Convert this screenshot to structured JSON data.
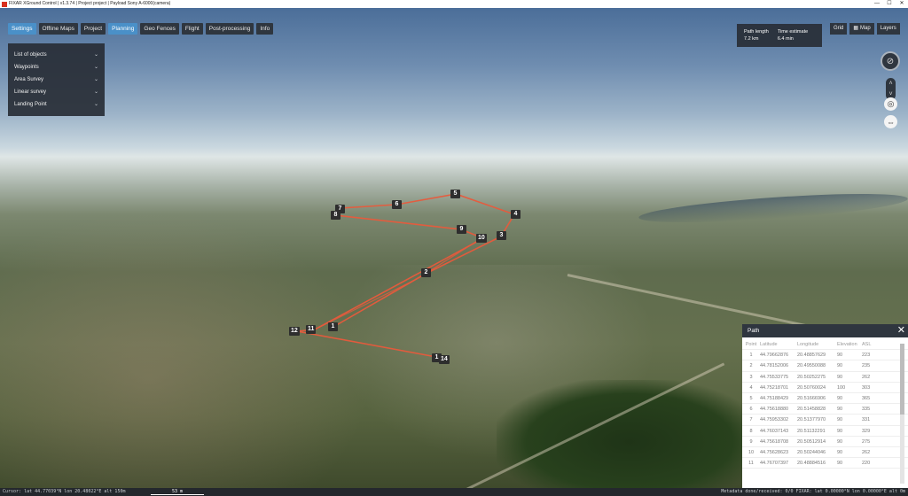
{
  "window": {
    "title": "FIXAR XGround Control | v1.3.74 | Project project | Payload Sony A-6000(camera)",
    "minimize": "—",
    "maximize": "☐",
    "close": "✕"
  },
  "menu": [
    "Settings",
    "Offline Maps",
    "Project",
    "Planning",
    "Geo Fences",
    "Flight",
    "Post-processing",
    "Info"
  ],
  "objects_panel": {
    "items": [
      "List of objects",
      "Waypoints",
      "Area Survey",
      "Linear survey",
      "Landing Point"
    ]
  },
  "path_info": {
    "length_label": "Path length",
    "length_value": "7.2 km",
    "time_label": "Time estimate",
    "time_value": "6.4 min"
  },
  "top_right": {
    "grid": "Grid",
    "map": "Map",
    "layers": "Layers"
  },
  "waypoints": [
    "1",
    "2",
    "3",
    "4",
    "5",
    "6",
    "7",
    "8",
    "9",
    "10",
    "11",
    "12",
    "1",
    "14"
  ],
  "path_panel": {
    "title": "Path",
    "columns": [
      "Point",
      "Latitude",
      "Longitude",
      "Elevation",
      "ASL"
    ],
    "rows": [
      [
        "1",
        "44.79662876",
        "20.48857629",
        "90",
        "223"
      ],
      [
        "2",
        "44.78152006",
        "20.49550088",
        "90",
        "235"
      ],
      [
        "3",
        "44.75533775",
        "20.50252275",
        "90",
        "262"
      ],
      [
        "4",
        "44.75218701",
        "20.50760024",
        "100",
        "303"
      ],
      [
        "5",
        "44.75188429",
        "20.51666906",
        "90",
        "365"
      ],
      [
        "6",
        "44.75618880",
        "20.51458828",
        "90",
        "335"
      ],
      [
        "7",
        "44.75953302",
        "20.51377970",
        "90",
        "331"
      ],
      [
        "8",
        "44.76037143",
        "20.51132291",
        "90",
        "329"
      ],
      [
        "9",
        "44.75618708",
        "20.50512914",
        "90",
        "275"
      ],
      [
        "10",
        "44.75628623",
        "20.50244046",
        "90",
        "262"
      ],
      [
        "11",
        "44.76707397",
        "20.48884516",
        "90",
        "220"
      ]
    ]
  },
  "status": {
    "cursor": "Cursor: lat 44.77039°N  lon 20.48022°E  alt 150m",
    "scale": "53 m",
    "right": "Metadata done/received: 0/0   FIXAR: lat 0.00000°N  lon 0.00000°E  alt 0m"
  }
}
